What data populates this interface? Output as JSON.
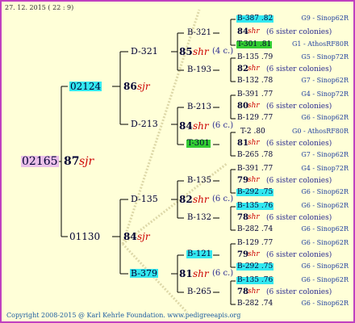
{
  "date": "27. 12. 2015 ( 22 :  9)",
  "footer": "Copyright 2008-2015 @ Karl Kehrle Foundation.   www.pedigreeapis.org",
  "root": {
    "id": "02165",
    "gen": "87",
    "mark": "sjr"
  },
  "parents": [
    {
      "id": "02124",
      "gen": "86",
      "mark": "sjr"
    },
    {
      "id": "01130",
      "gen": "84",
      "mark": "sjr"
    }
  ],
  "grandparents": [
    {
      "id": "D-321",
      "gen": "85",
      "mark": "shr",
      "note": "(4 c.)"
    },
    {
      "id": "D-213",
      "gen": "84",
      "mark": "shr",
      "note": "(6 c.)"
    },
    {
      "id": "D-135",
      "gen": "82",
      "mark": "shr",
      "note": "(6 c.)"
    },
    {
      "id": "B-379",
      "gen": "81",
      "mark": "shr",
      "note": "(6 c.)"
    }
  ],
  "greatgrandparents": [
    "B-321",
    "B-193",
    "B-213",
    "T-301",
    "B-135",
    "B-132",
    "B-121",
    "B-265"
  ],
  "g4": [
    {
      "gen": "84",
      "mark": "shr",
      "note": "(6 sister colonies)"
    },
    {
      "gen": "82",
      "mark": "shr",
      "note": "(6 sister colonies)"
    },
    {
      "gen": "80",
      "mark": "shr",
      "note": "(6 sister colonies)"
    },
    {
      "gen": "81",
      "mark": "shr",
      "note": "(6 sister colonies)"
    },
    {
      "gen": "79",
      "mark": "shr",
      "note": "(6 sister colonies)"
    },
    {
      "gen": "78",
      "mark": "shr",
      "note": "(6 sister colonies)"
    },
    {
      "gen": "79",
      "mark": "shr",
      "note": "(6 sister colonies)"
    },
    {
      "gen": "78",
      "mark": "shr",
      "note": "(6 sister colonies)"
    }
  ],
  "leaves": [
    {
      "id": "B-387 .82",
      "right": "G9 - Sinop62R"
    },
    {
      "id": "T-301 .81",
      "right": "G1 - AthosRF80R"
    },
    {
      "id": "B-135 .79",
      "right": "G5 - Sinop72R"
    },
    {
      "id": "B-132 .78",
      "right": "G7 - Sinop62R"
    },
    {
      "id": "B-391 .77",
      "right": "G4 - Sinop72R"
    },
    {
      "id": "B-129 .77",
      "right": "G6 - Sinop62R"
    },
    {
      "id": "T-2 .80",
      "right": "G0 - AthosRF80R"
    },
    {
      "id": "B-265 .78",
      "right": "G7 - Sinop62R"
    },
    {
      "id": "B-391 .77",
      "right": "G4 - Sinop72R"
    },
    {
      "id": "B-292 .75",
      "right": "G6 - Sinop62R"
    },
    {
      "id": "B-135 .76",
      "right": "G6 - Sinop62R"
    },
    {
      "id": "B-282 .74",
      "right": "G6 - Sinop62R"
    },
    {
      "id": "B-129 .77",
      "right": "G6 - Sinop62R"
    },
    {
      "id": "B-292 .75",
      "right": "G6 - Sinop62R"
    },
    {
      "id": "B-135 .76",
      "right": "G6 - Sinop62R"
    },
    {
      "id": "B-282 .74",
      "right": "G6 - Sinop62R"
    }
  ]
}
